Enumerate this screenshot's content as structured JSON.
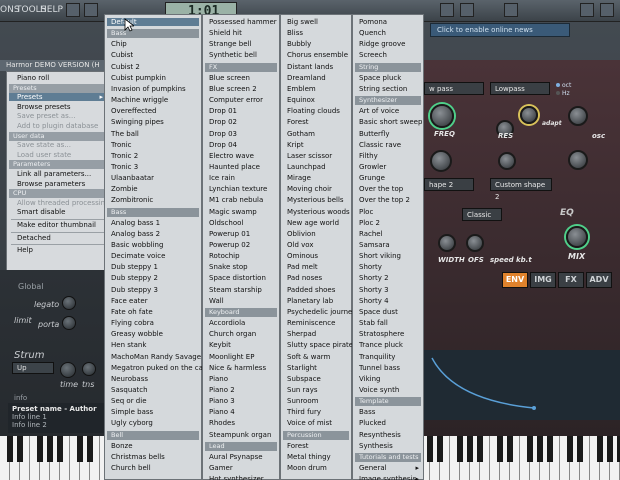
{
  "topbar": {
    "menu": [
      "ONS",
      "TOOLS",
      "HELP"
    ],
    "time": "1:01",
    "online_hint": "Click to enable online news"
  },
  "plugin_title": "Harmor DEMO VERSION (H",
  "context_menu": {
    "items": [
      {
        "type": "item",
        "label": "Piano roll"
      },
      {
        "type": "section",
        "label": "Presets"
      },
      {
        "type": "item",
        "label": "Presets",
        "arrow": "▸",
        "hi": true
      },
      {
        "type": "item",
        "label": "Browse presets"
      },
      {
        "type": "item",
        "label": "Save preset as...",
        "dis": true
      },
      {
        "type": "item",
        "label": "Add to plugin database",
        "dis": true
      },
      {
        "type": "section",
        "label": "User data"
      },
      {
        "type": "item",
        "label": "Save state as...",
        "dis": true
      },
      {
        "type": "item",
        "label": "Load user state",
        "dis": true
      },
      {
        "type": "section",
        "label": "Parameters"
      },
      {
        "type": "item",
        "label": "Link all parameters..."
      },
      {
        "type": "item",
        "label": "Browse parameters"
      },
      {
        "type": "section",
        "label": "CPU"
      },
      {
        "type": "item",
        "label": "Allow threaded processing",
        "dis": true
      },
      {
        "type": "item",
        "label": "Smart disable"
      },
      {
        "type": "sep"
      },
      {
        "type": "item",
        "label": "Make editor thumbnail"
      },
      {
        "type": "sep"
      },
      {
        "type": "item",
        "label": "Detached"
      },
      {
        "type": "sep"
      },
      {
        "type": "item",
        "label": "Help"
      }
    ]
  },
  "left_panel": {
    "global_label": "Global",
    "legato_label": "legato",
    "limit_label": "limit",
    "porta_label": "porta",
    "strum_label": "Strum",
    "strum_value": "Up",
    "time_label": "time",
    "tns_label": "tns",
    "info_label": "info",
    "preset_name": "Preset name - Author",
    "info_line1": "Info line 1",
    "info_line2": "Info line 2"
  },
  "columns": [
    {
      "items": [
        {
          "type": "item",
          "label": "Default",
          "hi": true
        },
        {
          "type": "section",
          "label": "Bass"
        },
        {
          "type": "item",
          "label": "Chip"
        },
        {
          "type": "item",
          "label": "Cubist"
        },
        {
          "type": "item",
          "label": "Cubist 2"
        },
        {
          "type": "item",
          "label": "Cubist pumpkin"
        },
        {
          "type": "item",
          "label": "Invasion of pumpkins"
        },
        {
          "type": "item",
          "label": "Machine wriggle"
        },
        {
          "type": "item",
          "label": "Overeffected"
        },
        {
          "type": "item",
          "label": "Swinging pipes"
        },
        {
          "type": "item",
          "label": "The ball"
        },
        {
          "type": "item",
          "label": "Tronic"
        },
        {
          "type": "item",
          "label": "Tronic 2"
        },
        {
          "type": "item",
          "label": "Tronic 3"
        },
        {
          "type": "item",
          "label": "Ulaanbaatar"
        },
        {
          "type": "item",
          "label": "Zombie"
        },
        {
          "type": "item",
          "label": "Zombitronic"
        },
        {
          "type": "section",
          "label": "Bass"
        },
        {
          "type": "item",
          "label": "Analog bass 1"
        },
        {
          "type": "item",
          "label": "Analog bass 2"
        },
        {
          "type": "item",
          "label": "Basic wobbling"
        },
        {
          "type": "item",
          "label": "Decimate voice"
        },
        {
          "type": "item",
          "label": "Dub steppy 1"
        },
        {
          "type": "item",
          "label": "Dub steppy 2"
        },
        {
          "type": "item",
          "label": "Dub steppy 3"
        },
        {
          "type": "item",
          "label": "Face eater"
        },
        {
          "type": "item",
          "label": "Fate oh fate"
        },
        {
          "type": "item",
          "label": "Flying cobra"
        },
        {
          "type": "item",
          "label": "Greasy wobble"
        },
        {
          "type": "item",
          "label": "Hen stank"
        },
        {
          "type": "item",
          "label": "MachoMan Randy Savage"
        },
        {
          "type": "item",
          "label": "Megatron puked on the cat"
        },
        {
          "type": "item",
          "label": "Neurobass"
        },
        {
          "type": "item",
          "label": "Sasquatch"
        },
        {
          "type": "item",
          "label": "Seq or die"
        },
        {
          "type": "item",
          "label": "Simple bass"
        },
        {
          "type": "item",
          "label": "Ugly cyborg"
        },
        {
          "type": "section",
          "label": "Bell"
        },
        {
          "type": "item",
          "label": "Bonze"
        },
        {
          "type": "item",
          "label": "Christmas bells"
        },
        {
          "type": "item",
          "label": "Church bell"
        }
      ]
    },
    {
      "items": [
        {
          "type": "item",
          "label": "Possessed hammer"
        },
        {
          "type": "item",
          "label": "Shield hit"
        },
        {
          "type": "item",
          "label": "Strange bell"
        },
        {
          "type": "item",
          "label": "Synthetic bell"
        },
        {
          "type": "section",
          "label": "FX"
        },
        {
          "type": "item",
          "label": "Blue screen"
        },
        {
          "type": "item",
          "label": "Blue screen 2"
        },
        {
          "type": "item",
          "label": "Computer error"
        },
        {
          "type": "item",
          "label": "Drop 01"
        },
        {
          "type": "item",
          "label": "Drop 02"
        },
        {
          "type": "item",
          "label": "Drop 03"
        },
        {
          "type": "item",
          "label": "Drop 04"
        },
        {
          "type": "item",
          "label": "Electro wave"
        },
        {
          "type": "item",
          "label": "Haunted place"
        },
        {
          "type": "item",
          "label": "Ice rain"
        },
        {
          "type": "item",
          "label": "Lynchian texture"
        },
        {
          "type": "item",
          "label": "M1 crab nebula"
        },
        {
          "type": "item",
          "label": "Magic swamp"
        },
        {
          "type": "item",
          "label": "Oldschool"
        },
        {
          "type": "item",
          "label": "Powerup 01"
        },
        {
          "type": "item",
          "label": "Powerup 02"
        },
        {
          "type": "item",
          "label": "Rotochip"
        },
        {
          "type": "item",
          "label": "Snake stop"
        },
        {
          "type": "item",
          "label": "Space distortion"
        },
        {
          "type": "item",
          "label": "Steam starship"
        },
        {
          "type": "item",
          "label": "Wall"
        },
        {
          "type": "section",
          "label": "Keyboard"
        },
        {
          "type": "item",
          "label": "Accordiola"
        },
        {
          "type": "item",
          "label": "Church organ"
        },
        {
          "type": "item",
          "label": "Keybit"
        },
        {
          "type": "item",
          "label": "Moonlight EP"
        },
        {
          "type": "item",
          "label": "Nice & harmless"
        },
        {
          "type": "item",
          "label": "Piano"
        },
        {
          "type": "item",
          "label": "Piano 2"
        },
        {
          "type": "item",
          "label": "Piano 3"
        },
        {
          "type": "item",
          "label": "Piano 4"
        },
        {
          "type": "item",
          "label": "Rhodes"
        },
        {
          "type": "item",
          "label": "Steampunk organ"
        },
        {
          "type": "section",
          "label": "Lead"
        },
        {
          "type": "item",
          "label": "Aural Psynapse"
        },
        {
          "type": "item",
          "label": "Gamer"
        },
        {
          "type": "item",
          "label": "Hot synthesizer"
        }
      ]
    },
    {
      "items": [
        {
          "type": "item",
          "label": "Big swell"
        },
        {
          "type": "item",
          "label": "Bliss"
        },
        {
          "type": "item",
          "label": "Bubbly"
        },
        {
          "type": "item",
          "label": "Chorus ensemble"
        },
        {
          "type": "item",
          "label": "Distant lands"
        },
        {
          "type": "item",
          "label": "Dreamland"
        },
        {
          "type": "item",
          "label": "Emblem"
        },
        {
          "type": "item",
          "label": "Equinox"
        },
        {
          "type": "item",
          "label": "Floating clouds"
        },
        {
          "type": "item",
          "label": "Forest"
        },
        {
          "type": "item",
          "label": "Gotham"
        },
        {
          "type": "item",
          "label": "Kript"
        },
        {
          "type": "item",
          "label": "Laser scissor"
        },
        {
          "type": "item",
          "label": "Launchpad"
        },
        {
          "type": "item",
          "label": "Mirage"
        },
        {
          "type": "item",
          "label": "Moving choir"
        },
        {
          "type": "item",
          "label": "Mysterious bells"
        },
        {
          "type": "item",
          "label": "Mysterious woods"
        },
        {
          "type": "item",
          "label": "New age world"
        },
        {
          "type": "item",
          "label": "Oblivion"
        },
        {
          "type": "item",
          "label": "Old vox"
        },
        {
          "type": "item",
          "label": "Ominous"
        },
        {
          "type": "item",
          "label": "Pad melt"
        },
        {
          "type": "item",
          "label": "Pad noses"
        },
        {
          "type": "item",
          "label": "Padded shoes"
        },
        {
          "type": "item",
          "label": "Planetary lab"
        },
        {
          "type": "item",
          "label": "Psychedelic journey"
        },
        {
          "type": "item",
          "label": "Reminiscence"
        },
        {
          "type": "item",
          "label": "Sherpad"
        },
        {
          "type": "item",
          "label": "Slutty space pirate"
        },
        {
          "type": "item",
          "label": "Soft & warm"
        },
        {
          "type": "item",
          "label": "Starlight"
        },
        {
          "type": "item",
          "label": "Subspace"
        },
        {
          "type": "item",
          "label": "Sun rays"
        },
        {
          "type": "item",
          "label": "Sunroom"
        },
        {
          "type": "item",
          "label": "Third fury"
        },
        {
          "type": "item",
          "label": "Voice of mist"
        },
        {
          "type": "section",
          "label": "Percussion"
        },
        {
          "type": "item",
          "label": "Forest"
        },
        {
          "type": "item",
          "label": "Metal thingy"
        },
        {
          "type": "item",
          "label": "Moon drum"
        }
      ]
    },
    {
      "items": [
        {
          "type": "item",
          "label": "Pomona"
        },
        {
          "type": "item",
          "label": "Quench"
        },
        {
          "type": "item",
          "label": "Ridge groove"
        },
        {
          "type": "item",
          "label": "Screech"
        },
        {
          "type": "section",
          "label": "String"
        },
        {
          "type": "item",
          "label": "Space pluck"
        },
        {
          "type": "item",
          "label": "String section"
        },
        {
          "type": "section",
          "label": "Synthesizer"
        },
        {
          "type": "item",
          "label": "Art of voice"
        },
        {
          "type": "item",
          "label": "Basic short sweep"
        },
        {
          "type": "item",
          "label": "Butterfly"
        },
        {
          "type": "item",
          "label": "Classic rave"
        },
        {
          "type": "item",
          "label": "Filthy"
        },
        {
          "type": "item",
          "label": "Growler"
        },
        {
          "type": "item",
          "label": "Grunge"
        },
        {
          "type": "item",
          "label": "Over the top"
        },
        {
          "type": "item",
          "label": "Over the top 2"
        },
        {
          "type": "item",
          "label": "Ploc"
        },
        {
          "type": "item",
          "label": "Ploc 2"
        },
        {
          "type": "item",
          "label": "Rachel"
        },
        {
          "type": "item",
          "label": "Samsara"
        },
        {
          "type": "item",
          "label": "Short viking"
        },
        {
          "type": "item",
          "label": "Shorty"
        },
        {
          "type": "item",
          "label": "Shorty 2"
        },
        {
          "type": "item",
          "label": "Shorty 3"
        },
        {
          "type": "item",
          "label": "Shorty 4"
        },
        {
          "type": "item",
          "label": "Space dust"
        },
        {
          "type": "item",
          "label": "Stab fall"
        },
        {
          "type": "item",
          "label": "Stratosphere"
        },
        {
          "type": "item",
          "label": "Trance pluck"
        },
        {
          "type": "item",
          "label": "Tranquility"
        },
        {
          "type": "item",
          "label": "Tunnel bass"
        },
        {
          "type": "item",
          "label": "Viking"
        },
        {
          "type": "item",
          "label": "Voice synth"
        },
        {
          "type": "section",
          "label": "Template"
        },
        {
          "type": "item",
          "label": "Bass"
        },
        {
          "type": "item",
          "label": "Plucked"
        },
        {
          "type": "item",
          "label": "Resynthesis"
        },
        {
          "type": "item",
          "label": "Synthesis"
        },
        {
          "type": "section",
          "label": "Tutorials and tests"
        },
        {
          "type": "item",
          "label": "General",
          "arrow": "▸"
        },
        {
          "type": "item",
          "label": "Image synthesis",
          "arrow": "▸"
        }
      ]
    }
  ],
  "synth": {
    "filter1": "w pass",
    "filter2": "Lowpass",
    "oct": "oct",
    "hz": "Hz",
    "freq": "FREQ",
    "res": "RES",
    "width": "width",
    "adapt": "adapt",
    "ofs": "ofs",
    "osc": "osc",
    "shape1": "hape 2",
    "shape2": "Custom shape 2",
    "mode": "Classic",
    "eq": "EQ",
    "mix": "MIX",
    "width2": "WIDTH",
    "ofs2": "OFS",
    "speed": "speed",
    "kbt": "kb.t",
    "tabs": [
      "ENV",
      "IMG",
      "FX",
      "ADV"
    ]
  },
  "colors": {
    "accent": "#5f7d94",
    "env_tab": "#e0822c",
    "knob_ring": "#4fd08a"
  }
}
